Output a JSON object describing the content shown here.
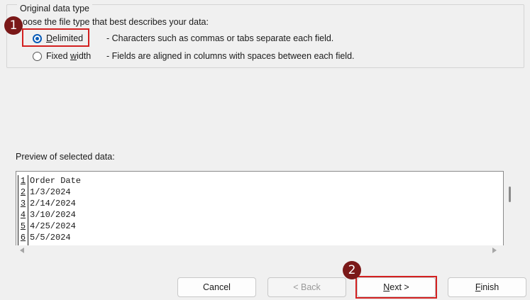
{
  "group": {
    "legend": "Original data type",
    "prompt": "oose the file type that best describes your data:",
    "options": [
      {
        "label_ul": "D",
        "label_rest": "elimited",
        "description": "- Characters such as commas or tabs separate each field.",
        "checked": true
      },
      {
        "label_pre": "Fixed ",
        "label_ul": "w",
        "label_rest": "idth",
        "description": "- Fields are aligned in columns with spaces between each field.",
        "checked": false
      }
    ]
  },
  "callouts": {
    "badge1": "1",
    "badge2": "2"
  },
  "preview": {
    "label": "Preview of selected data:",
    "rows": [
      {
        "num": "1",
        "value": "Order Date"
      },
      {
        "num": "2",
        "value": "1/3/2024"
      },
      {
        "num": "3",
        "value": "2/14/2024"
      },
      {
        "num": "4",
        "value": "3/10/2024"
      },
      {
        "num": "5",
        "value": "4/25/2024"
      },
      {
        "num": "6",
        "value": "5/5/2024"
      }
    ]
  },
  "buttons": {
    "cancel": "Cancel",
    "back": "< Back",
    "next_ul": "N",
    "next_rest": "ext >",
    "finish_ul": "F",
    "finish_rest": "inish"
  },
  "colors": {
    "accent": "#0a5cb8",
    "callout_border": "#d32020",
    "badge": "#7a1818"
  }
}
